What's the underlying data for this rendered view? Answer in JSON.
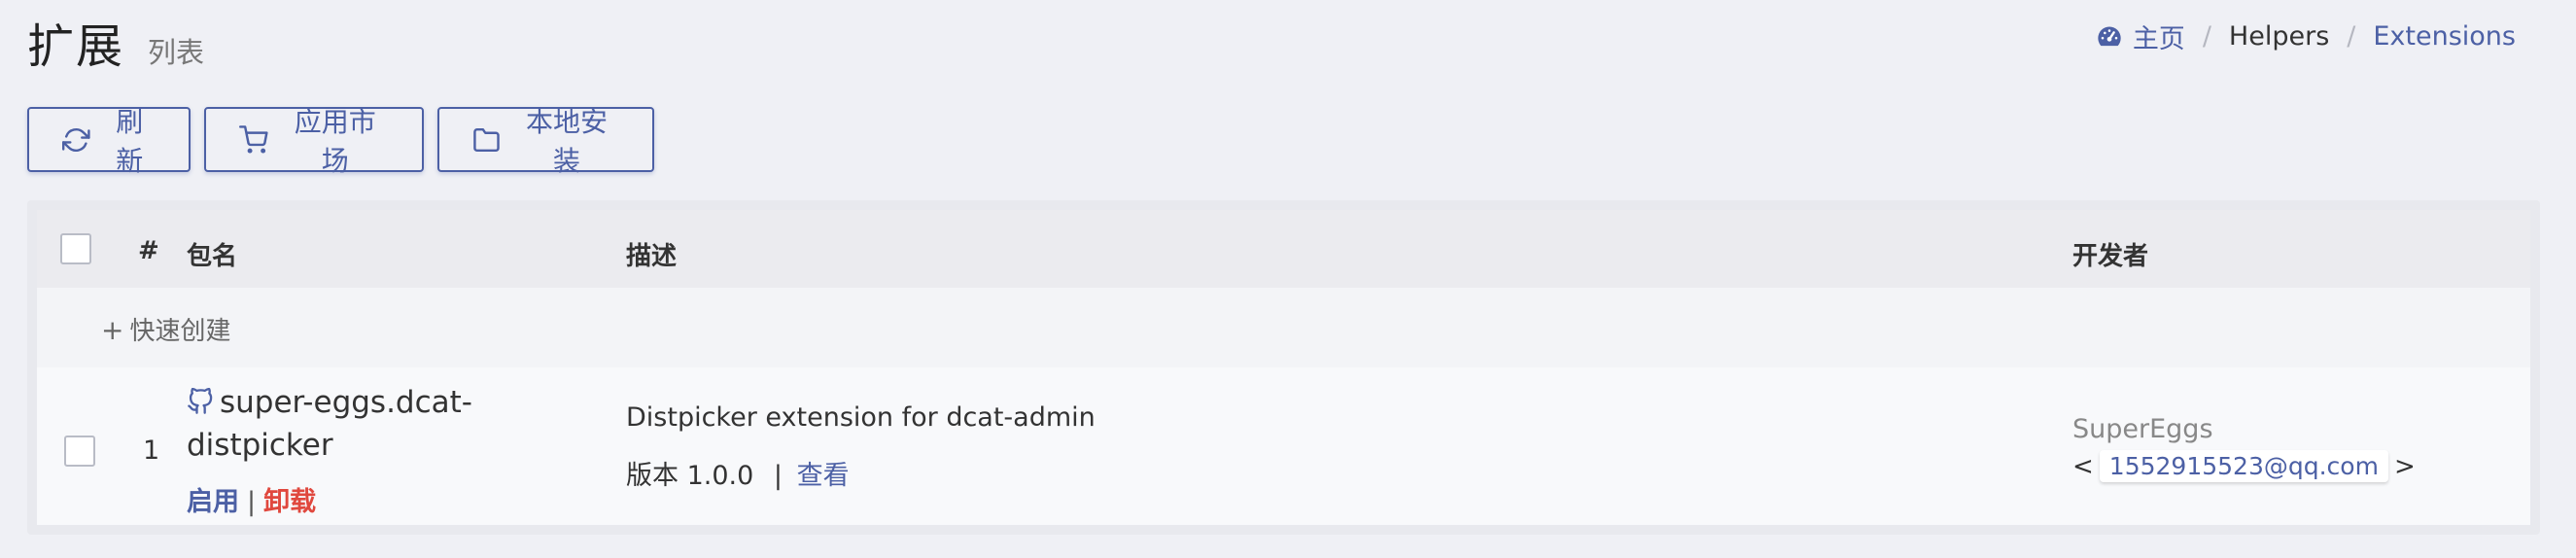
{
  "header": {
    "title": "扩展",
    "subtitle": "列表"
  },
  "breadcrumb": {
    "home": "主页",
    "helpers": "Helpers",
    "extensions": "Extensions",
    "separator": "/"
  },
  "toolbar": {
    "refresh": "刷新",
    "market": "应用市场",
    "local_install": "本地安装"
  },
  "table": {
    "columns": {
      "index": "#",
      "package": "包名",
      "description": "描述",
      "developer": "开发者"
    },
    "quick_create": "快速创建",
    "rows": [
      {
        "index": "1",
        "package": "super-eggs.dcat-distpicker",
        "enable": "启用",
        "uninstall": "卸载",
        "description": "Distpicker extension for dcat-admin",
        "version_label": "版本 1.0.0",
        "view": "查看",
        "developer": "SuperEggs",
        "email": "1552915523@qq.com",
        "email_open": "<",
        "email_close": ">"
      }
    ]
  },
  "colors": {
    "accent": "#4c60a5",
    "danger": "#e0483e",
    "background": "#eff0f5"
  }
}
